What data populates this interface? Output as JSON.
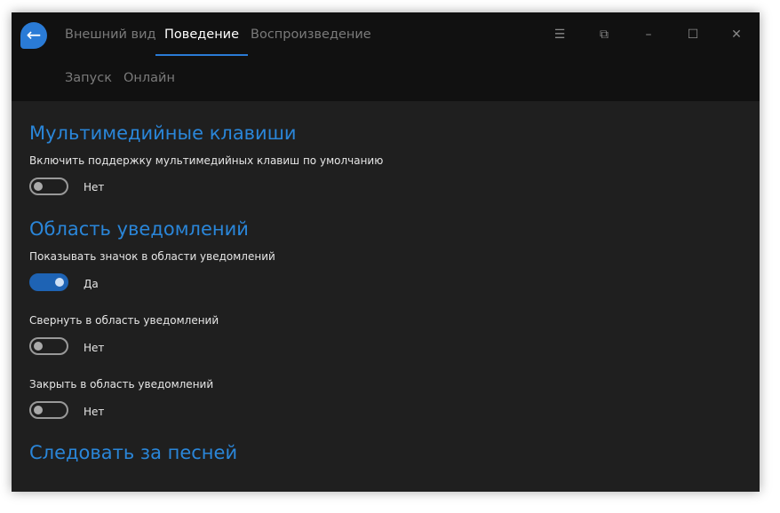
{
  "tabs": [
    "Внешний вид",
    "Поведение",
    "Воспроизведение"
  ],
  "subtabs": [
    "Запуск",
    "Онлайн"
  ],
  "sections": {
    "media": {
      "title": "Мультимедийные клавиши",
      "setting": "Включить поддержку мультимедийных клавиш по умолчанию",
      "on": false,
      "value": "Нет"
    },
    "tray": {
      "title": "Область уведомлений",
      "settings": [
        {
          "label": "Показывать значок в области уведомлений",
          "on": true,
          "value": "Да"
        },
        {
          "label": "Свернуть в область уведомлений",
          "on": false,
          "value": "Нет"
        },
        {
          "label": "Закрыть в область уведомлений",
          "on": false,
          "value": "Нет"
        }
      ]
    },
    "follow": {
      "title": "Следовать за песней"
    }
  },
  "accent": "#2a7bd6"
}
